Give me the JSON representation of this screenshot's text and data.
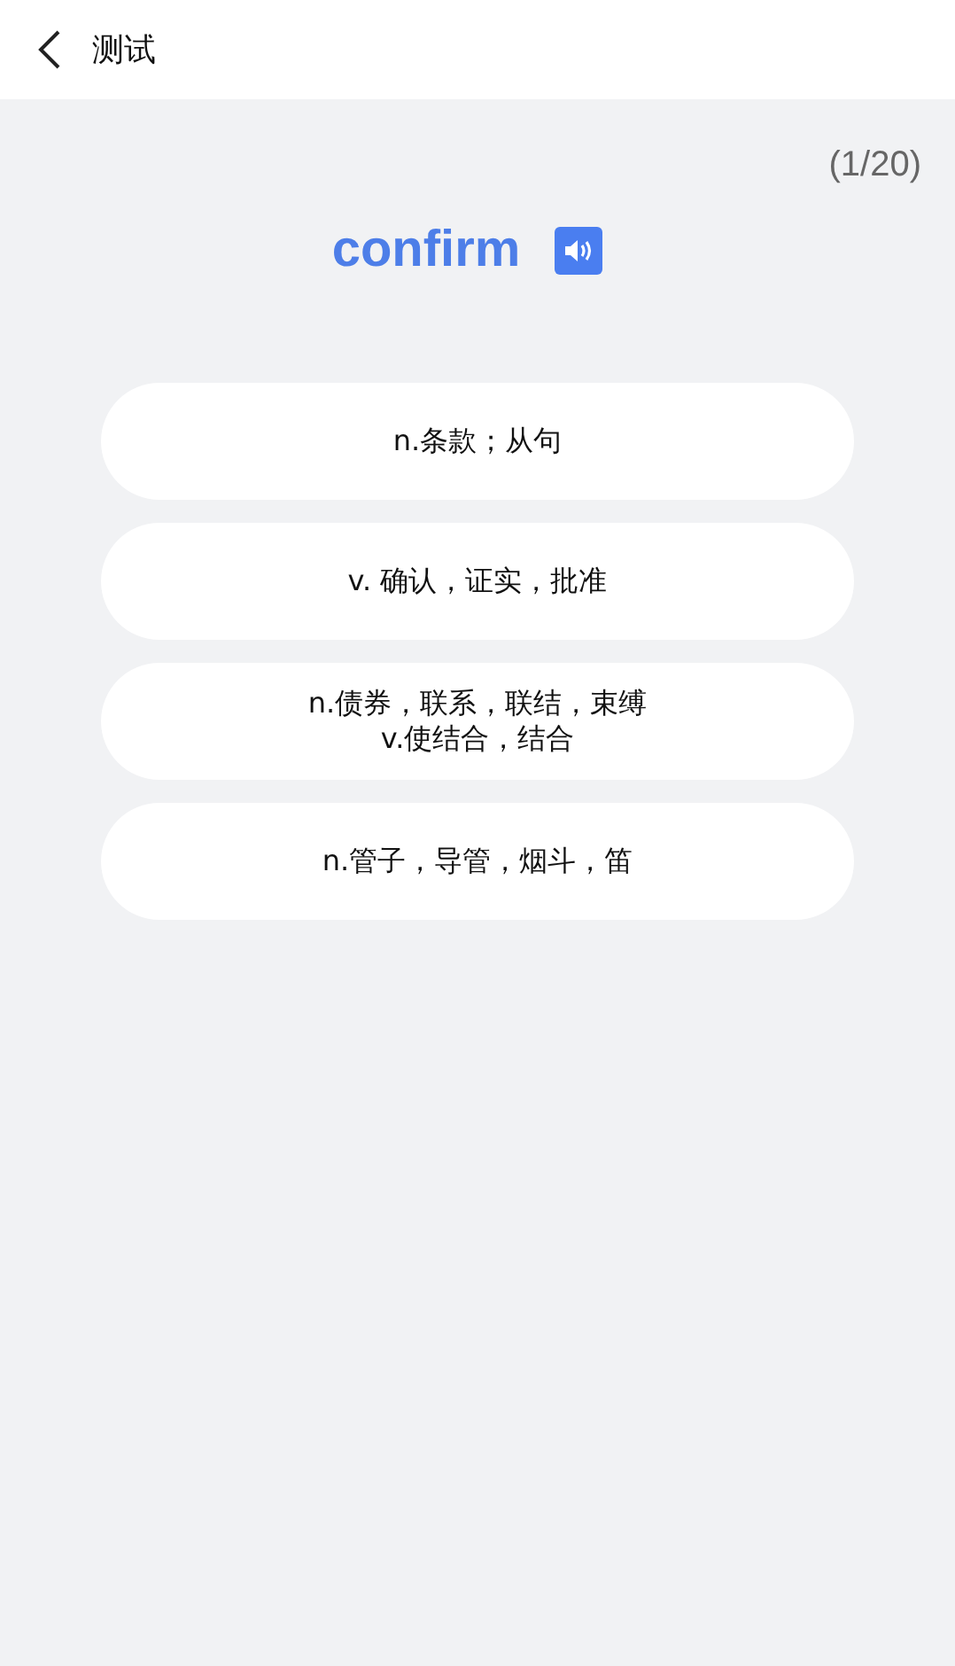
{
  "header": {
    "title": "测试"
  },
  "progress": "(1/20)",
  "word": "confirm",
  "options": [
    {
      "lines": [
        "n.条款；从句"
      ]
    },
    {
      "lines": [
        "v. 确认，证实，批准"
      ]
    },
    {
      "lines": [
        "n.债券，联系，联结，束缚",
        "v.使结合，结合"
      ]
    },
    {
      "lines": [
        "n.管子，导管，烟斗，笛"
      ]
    }
  ]
}
